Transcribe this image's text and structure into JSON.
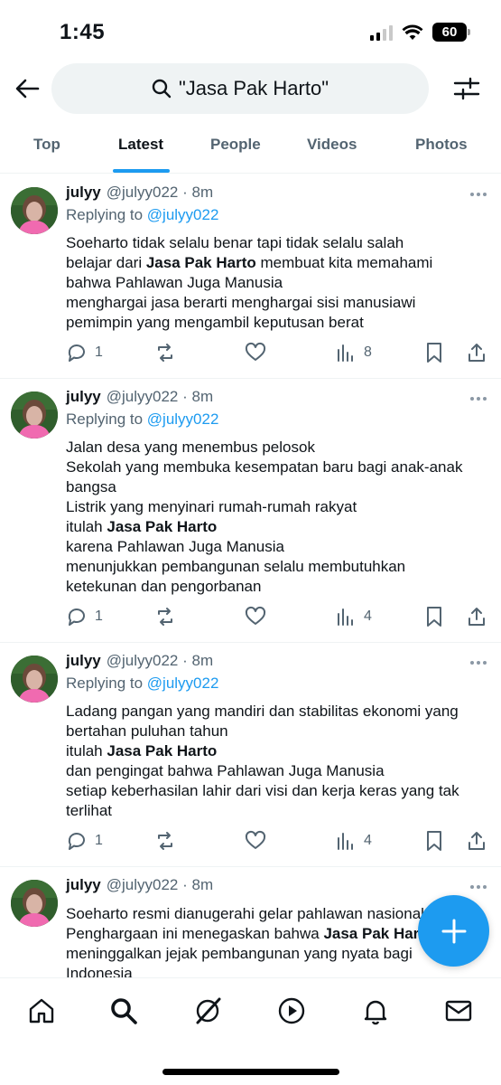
{
  "status_bar": {
    "time": "1:45",
    "battery": "60"
  },
  "search": {
    "query": "\"Jasa Pak Harto\""
  },
  "tabs": [
    {
      "label": "Top"
    },
    {
      "label": "Latest"
    },
    {
      "label": "People"
    },
    {
      "label": "Videos"
    },
    {
      "label": "Photos"
    }
  ],
  "active_tab": "Latest",
  "tweets": [
    {
      "name": "julyy",
      "handle": "@julyy022",
      "time": "8m",
      "replying_prefix": "Replying to",
      "replying_handle": "@julyy022",
      "lines": [
        [
          "Soeharto tidak selalu benar tapi tidak selalu salah"
        ],
        [
          "belajar dari ",
          "Jasa Pak Harto",
          " membuat kita memahami"
        ],
        [
          "bahwa Pahlawan Juga Manusia"
        ],
        [
          "menghargai jasa berarti menghargai sisi manusiawi"
        ],
        [
          "pemimpin yang mengambil keputusan berat"
        ]
      ],
      "replies": "1",
      "views": "8"
    },
    {
      "name": "julyy",
      "handle": "@julyy022",
      "time": "8m",
      "replying_prefix": "Replying to",
      "replying_handle": "@julyy022",
      "lines": [
        [
          "Jalan desa yang menembus pelosok"
        ],
        [
          "Sekolah yang membuka kesempatan baru bagi anak-anak"
        ],
        [
          "bangsa"
        ],
        [
          "Listrik yang menyinari rumah-rumah rakyat"
        ],
        [
          "itulah ",
          "Jasa Pak Harto",
          ""
        ],
        [
          "karena Pahlawan Juga Manusia"
        ],
        [
          "menunjukkan pembangunan selalu membutuhkan"
        ],
        [
          "ketekunan dan pengorbanan"
        ]
      ],
      "replies": "1",
      "views": "4"
    },
    {
      "name": "julyy",
      "handle": "@julyy022",
      "time": "8m",
      "replying_prefix": "Replying to",
      "replying_handle": "@julyy022",
      "lines": [
        [
          "Ladang pangan yang mandiri dan stabilitas ekonomi yang"
        ],
        [
          "bertahan puluhan tahun"
        ],
        [
          "itulah ",
          "Jasa Pak Harto",
          ""
        ],
        [
          "dan pengingat bahwa Pahlawan Juga Manusia"
        ],
        [
          "setiap keberhasilan lahir dari visi dan kerja keras yang tak"
        ],
        [
          "terlihat"
        ]
      ],
      "replies": "1",
      "views": "4"
    },
    {
      "name": "julyy",
      "handle": "@julyy022",
      "time": "8m",
      "lines": [
        [
          "Soeharto resmi dianugerahi gelar pahlawan nasional"
        ],
        [
          "Penghargaan ini menegaskan bahwa ",
          "Jasa Pak Harto",
          ""
        ],
        [
          "meninggalkan jejak pembangunan yang nyata bagi"
        ],
        [
          "Indonesia"
        ]
      ]
    }
  ],
  "colors": {
    "accent": "#1d9bf0",
    "text": "#0f1419",
    "muted": "#536471"
  },
  "icons": {
    "back": "arrow-left-icon",
    "search": "search-icon",
    "filter": "filter-sliders-icon",
    "reply": "reply-icon",
    "retweet": "retweet-icon",
    "like": "heart-icon",
    "views": "views-icon",
    "bookmark": "bookmark-icon",
    "share": "share-icon",
    "compose": "plus-icon",
    "home": "home-icon",
    "explore": "search-icon",
    "grok": "grok-icon",
    "video": "play-icon",
    "notifications": "bell-icon",
    "messages": "mail-icon"
  }
}
